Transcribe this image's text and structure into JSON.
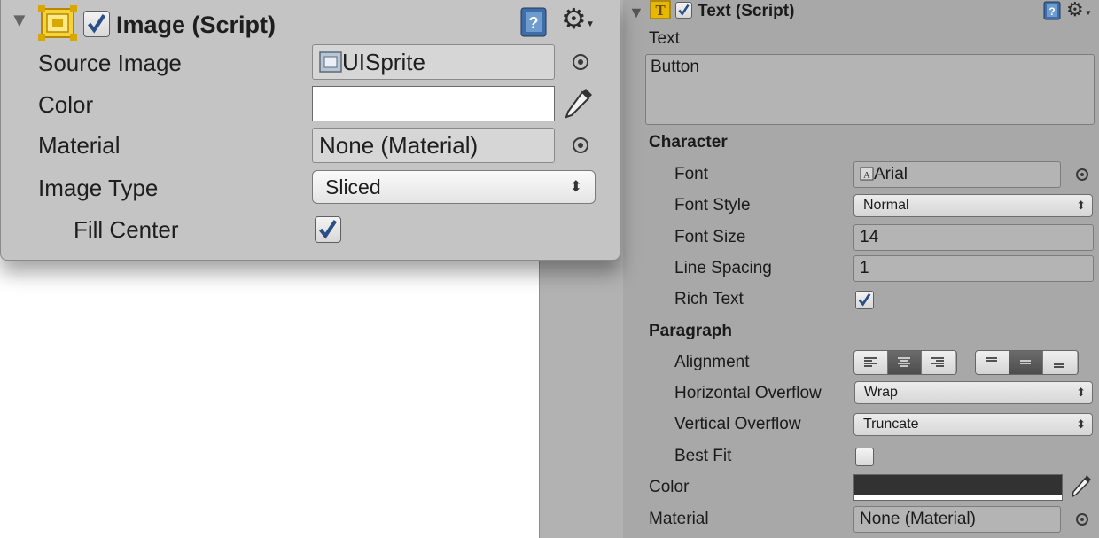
{
  "image_component": {
    "title": "Image (Script)",
    "enabled": true,
    "source_image": {
      "label": "Source Image",
      "value": "UISprite"
    },
    "color": {
      "label": "Color",
      "value": "#ffffff"
    },
    "material": {
      "label": "Material",
      "value": "None (Material)"
    },
    "image_type": {
      "label": "Image Type",
      "value": "Sliced"
    },
    "fill_center": {
      "label": "Fill Center",
      "checked": true
    }
  },
  "text_component": {
    "title": "Text (Script)",
    "enabled": true,
    "text": {
      "label": "Text",
      "value": "Button"
    },
    "character": {
      "heading": "Character",
      "font": {
        "label": "Font",
        "value": "Arial"
      },
      "font_style": {
        "label": "Font Style",
        "value": "Normal"
      },
      "font_size": {
        "label": "Font Size",
        "value": "14"
      },
      "line_spacing": {
        "label": "Line Spacing",
        "value": "1"
      },
      "rich_text": {
        "label": "Rich Text",
        "checked": true
      }
    },
    "paragraph": {
      "heading": "Paragraph",
      "alignment": {
        "label": "Alignment",
        "horizontal_selected": "center",
        "vertical_selected": "middle"
      },
      "horizontal_overflow": {
        "label": "Horizontal Overflow",
        "value": "Wrap"
      },
      "vertical_overflow": {
        "label": "Vertical Overflow",
        "value": "Truncate"
      },
      "best_fit": {
        "label": "Best Fit",
        "checked": false
      }
    },
    "color": {
      "label": "Color",
      "value": "#323232"
    },
    "material": {
      "label": "Material",
      "value": "None (Material)"
    }
  },
  "colors": {
    "checkbox_check": "#2a4f86",
    "icon_yellow": "#e8b800",
    "help_blue": "#3d6ea8"
  }
}
